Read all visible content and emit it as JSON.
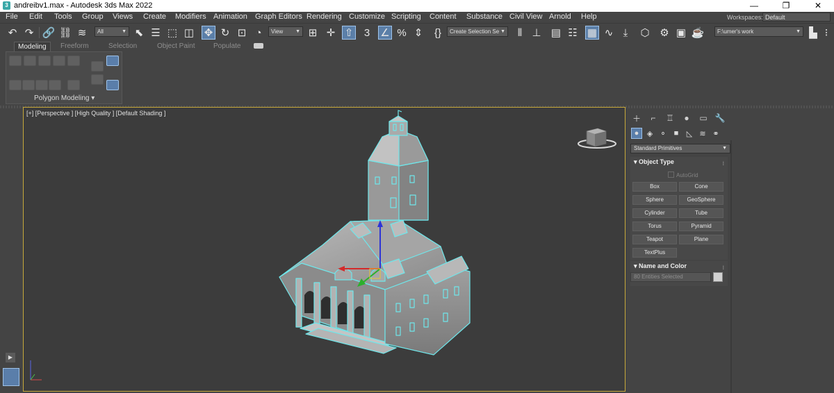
{
  "titlebar": {
    "icon_letter": "3",
    "title": "andreibv1.max - Autodesk 3ds Max 2022",
    "minimize": "—",
    "maximize": "❐",
    "close": "✕"
  },
  "menu": {
    "items": [
      "File",
      "Edit",
      "Tools",
      "Group",
      "Views",
      "Create",
      "Modifiers",
      "Animation",
      "Graph Editors",
      "Rendering",
      "Customize",
      "Scripting",
      "Content",
      "Substance",
      "Civil View",
      "Arnold",
      "Help"
    ],
    "workspaces_label": "Workspaces:",
    "workspace_value": "Default"
  },
  "toolbar": {
    "filter_value": "All",
    "view_value": "View",
    "selection_set_value": "Create Selection Se",
    "project_path": "F:\\umer's work"
  },
  "ribbon": {
    "tabs": [
      "Modeling",
      "Freeform",
      "Selection",
      "Object Paint",
      "Populate"
    ],
    "panel_label": "Polygon Modeling ▾"
  },
  "viewport": {
    "label": "[+] [Perspective ] [High Quality ] [Default Shading ]",
    "selection_color": "#6fe6ea",
    "border_color": "#c8a93a"
  },
  "command_panel": {
    "category_dropdown": "Standard Primitives",
    "object_type_title": "Object Type",
    "autogrid_label": "AutoGrid",
    "object_buttons": [
      "Box",
      "Cone",
      "Sphere",
      "GeoSphere",
      "Cylinder",
      "Tube",
      "Torus",
      "Pyramid",
      "Teapot",
      "Plane",
      "TextPlus"
    ],
    "name_color_title": "Name and Color",
    "name_field_value": "80 Entities Selected",
    "rollout_expanded_glyph": "▾",
    "swatch_color": "#d2d2d2"
  }
}
